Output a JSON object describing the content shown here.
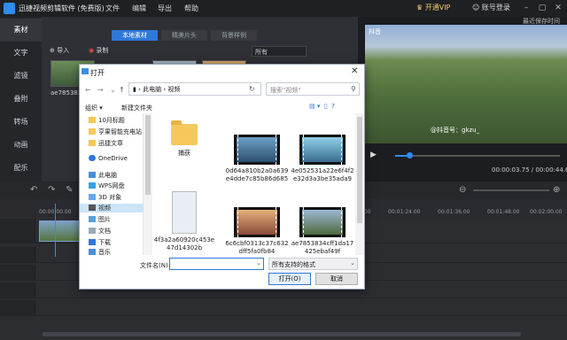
{
  "app": {
    "title": "迅捷视频剪辑软件 (免费版)",
    "menu": [
      "文件",
      "编辑",
      "导出",
      "帮助"
    ],
    "vip": "开通VIP",
    "login": "账号登录"
  },
  "rail": [
    "素材",
    "文字",
    "滤镜",
    "叠附",
    "转场",
    "动画",
    "配乐"
  ],
  "media": {
    "tabs": [
      "本地素材",
      "精美片头",
      "背景样例"
    ],
    "import": "导入",
    "record": "录制",
    "sort": "所有",
    "thumb_label": "ae785383..."
  },
  "preview": {
    "label": "最近保存时间",
    "tiktok": "抖音",
    "watermark": "@抖音号：gkzu_",
    "timecode": "00:00:03.75 / 00:00:44.60",
    "progress": 0.084
  },
  "timeline": {
    "ticks": [
      "00:00:00.00",
      "00:01:12.00",
      "00:01:24.00",
      "00:01:36.00",
      "00:01:48.00",
      "00:02:00.00"
    ]
  },
  "dialog": {
    "title": "打开",
    "path": [
      "此电脑",
      "视频"
    ],
    "search_placeholder": "搜索\"视频\"",
    "organize": "组织 ▾",
    "new_folder": "新建文件夹",
    "nav": [
      "10月标题",
      "亨果智能充电站",
      "迅捷文章",
      "OneDrive",
      "此电脑",
      "WPS网盘",
      "3D 对象",
      "视频",
      "图片",
      "文档",
      "下载",
      "音乐"
    ],
    "files": [
      {
        "name": "捕获",
        "kind": "folder"
      },
      {
        "name": "0d64a810b2a0a639e4dde7c85b86d685",
        "kind": "video"
      },
      {
        "name": "4e052531a22e6f4f2e32d3a3be35ada9",
        "kind": "video"
      },
      {
        "name": "4f3a2a60920c453e47d14302b",
        "kind": "portrait"
      },
      {
        "name": "6c6cbf0313c37c632dff5fa0fb84",
        "kind": "video"
      },
      {
        "name": "ae7853834cff1da17425ebaf49f",
        "kind": "video"
      }
    ],
    "filename_label": "文件名(N):",
    "filename_value": "",
    "filter": "所有支持的格式",
    "open_btn": "打开(O)",
    "cancel_btn": "取消"
  }
}
